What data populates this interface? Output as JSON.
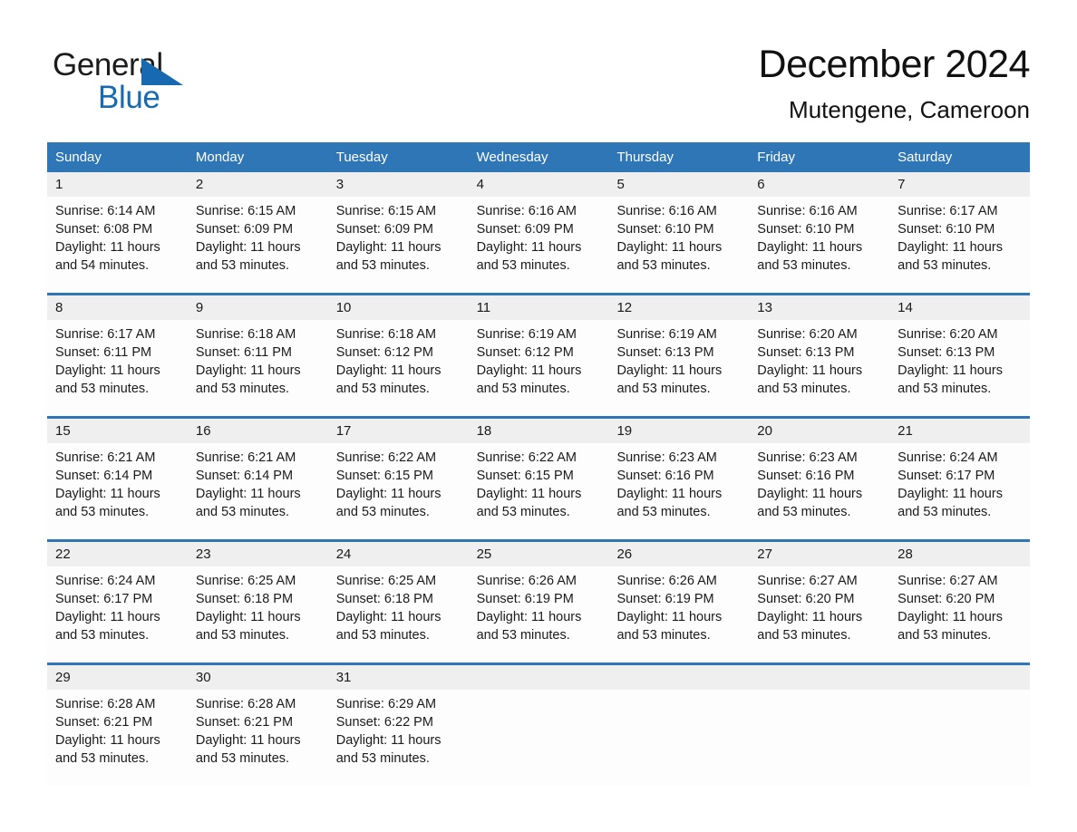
{
  "brand": {
    "word_one": "General",
    "word_two": "Blue",
    "triangle_color": "#1769b0",
    "blue_text_color": "#1769b0"
  },
  "header": {
    "month_title": "December 2024",
    "location": "Mutengene, Cameroon"
  },
  "theme": {
    "header_blue": "#2f76b6",
    "date_band_gray": "#efefef",
    "rule_blue": "#2f76b6"
  },
  "calendar": {
    "day_headers": [
      "Sunday",
      "Monday",
      "Tuesday",
      "Wednesday",
      "Thursday",
      "Friday",
      "Saturday"
    ],
    "weeks": [
      {
        "dates": [
          "1",
          "2",
          "3",
          "4",
          "5",
          "6",
          "7"
        ],
        "cells": [
          {
            "sunrise": "Sunrise: 6:14 AM",
            "sunset": "Sunset: 6:08 PM",
            "daylight_a": "Daylight: 11 hours",
            "daylight_b": "and 54 minutes."
          },
          {
            "sunrise": "Sunrise: 6:15 AM",
            "sunset": "Sunset: 6:09 PM",
            "daylight_a": "Daylight: 11 hours",
            "daylight_b": "and 53 minutes."
          },
          {
            "sunrise": "Sunrise: 6:15 AM",
            "sunset": "Sunset: 6:09 PM",
            "daylight_a": "Daylight: 11 hours",
            "daylight_b": "and 53 minutes."
          },
          {
            "sunrise": "Sunrise: 6:16 AM",
            "sunset": "Sunset: 6:09 PM",
            "daylight_a": "Daylight: 11 hours",
            "daylight_b": "and 53 minutes."
          },
          {
            "sunrise": "Sunrise: 6:16 AM",
            "sunset": "Sunset: 6:10 PM",
            "daylight_a": "Daylight: 11 hours",
            "daylight_b": "and 53 minutes."
          },
          {
            "sunrise": "Sunrise: 6:16 AM",
            "sunset": "Sunset: 6:10 PM",
            "daylight_a": "Daylight: 11 hours",
            "daylight_b": "and 53 minutes."
          },
          {
            "sunrise": "Sunrise: 6:17 AM",
            "sunset": "Sunset: 6:10 PM",
            "daylight_a": "Daylight: 11 hours",
            "daylight_b": "and 53 minutes."
          }
        ]
      },
      {
        "dates": [
          "8",
          "9",
          "10",
          "11",
          "12",
          "13",
          "14"
        ],
        "cells": [
          {
            "sunrise": "Sunrise: 6:17 AM",
            "sunset": "Sunset: 6:11 PM",
            "daylight_a": "Daylight: 11 hours",
            "daylight_b": "and 53 minutes."
          },
          {
            "sunrise": "Sunrise: 6:18 AM",
            "sunset": "Sunset: 6:11 PM",
            "daylight_a": "Daylight: 11 hours",
            "daylight_b": "and 53 minutes."
          },
          {
            "sunrise": "Sunrise: 6:18 AM",
            "sunset": "Sunset: 6:12 PM",
            "daylight_a": "Daylight: 11 hours",
            "daylight_b": "and 53 minutes."
          },
          {
            "sunrise": "Sunrise: 6:19 AM",
            "sunset": "Sunset: 6:12 PM",
            "daylight_a": "Daylight: 11 hours",
            "daylight_b": "and 53 minutes."
          },
          {
            "sunrise": "Sunrise: 6:19 AM",
            "sunset": "Sunset: 6:13 PM",
            "daylight_a": "Daylight: 11 hours",
            "daylight_b": "and 53 minutes."
          },
          {
            "sunrise": "Sunrise: 6:20 AM",
            "sunset": "Sunset: 6:13 PM",
            "daylight_a": "Daylight: 11 hours",
            "daylight_b": "and 53 minutes."
          },
          {
            "sunrise": "Sunrise: 6:20 AM",
            "sunset": "Sunset: 6:13 PM",
            "daylight_a": "Daylight: 11 hours",
            "daylight_b": "and 53 minutes."
          }
        ]
      },
      {
        "dates": [
          "15",
          "16",
          "17",
          "18",
          "19",
          "20",
          "21"
        ],
        "cells": [
          {
            "sunrise": "Sunrise: 6:21 AM",
            "sunset": "Sunset: 6:14 PM",
            "daylight_a": "Daylight: 11 hours",
            "daylight_b": "and 53 minutes."
          },
          {
            "sunrise": "Sunrise: 6:21 AM",
            "sunset": "Sunset: 6:14 PM",
            "daylight_a": "Daylight: 11 hours",
            "daylight_b": "and 53 minutes."
          },
          {
            "sunrise": "Sunrise: 6:22 AM",
            "sunset": "Sunset: 6:15 PM",
            "daylight_a": "Daylight: 11 hours",
            "daylight_b": "and 53 minutes."
          },
          {
            "sunrise": "Sunrise: 6:22 AM",
            "sunset": "Sunset: 6:15 PM",
            "daylight_a": "Daylight: 11 hours",
            "daylight_b": "and 53 minutes."
          },
          {
            "sunrise": "Sunrise: 6:23 AM",
            "sunset": "Sunset: 6:16 PM",
            "daylight_a": "Daylight: 11 hours",
            "daylight_b": "and 53 minutes."
          },
          {
            "sunrise": "Sunrise: 6:23 AM",
            "sunset": "Sunset: 6:16 PM",
            "daylight_a": "Daylight: 11 hours",
            "daylight_b": "and 53 minutes."
          },
          {
            "sunrise": "Sunrise: 6:24 AM",
            "sunset": "Sunset: 6:17 PM",
            "daylight_a": "Daylight: 11 hours",
            "daylight_b": "and 53 minutes."
          }
        ]
      },
      {
        "dates": [
          "22",
          "23",
          "24",
          "25",
          "26",
          "27",
          "28"
        ],
        "cells": [
          {
            "sunrise": "Sunrise: 6:24 AM",
            "sunset": "Sunset: 6:17 PM",
            "daylight_a": "Daylight: 11 hours",
            "daylight_b": "and 53 minutes."
          },
          {
            "sunrise": "Sunrise: 6:25 AM",
            "sunset": "Sunset: 6:18 PM",
            "daylight_a": "Daylight: 11 hours",
            "daylight_b": "and 53 minutes."
          },
          {
            "sunrise": "Sunrise: 6:25 AM",
            "sunset": "Sunset: 6:18 PM",
            "daylight_a": "Daylight: 11 hours",
            "daylight_b": "and 53 minutes."
          },
          {
            "sunrise": "Sunrise: 6:26 AM",
            "sunset": "Sunset: 6:19 PM",
            "daylight_a": "Daylight: 11 hours",
            "daylight_b": "and 53 minutes."
          },
          {
            "sunrise": "Sunrise: 6:26 AM",
            "sunset": "Sunset: 6:19 PM",
            "daylight_a": "Daylight: 11 hours",
            "daylight_b": "and 53 minutes."
          },
          {
            "sunrise": "Sunrise: 6:27 AM",
            "sunset": "Sunset: 6:20 PM",
            "daylight_a": "Daylight: 11 hours",
            "daylight_b": "and 53 minutes."
          },
          {
            "sunrise": "Sunrise: 6:27 AM",
            "sunset": "Sunset: 6:20 PM",
            "daylight_a": "Daylight: 11 hours",
            "daylight_b": "and 53 minutes."
          }
        ]
      },
      {
        "dates": [
          "29",
          "30",
          "31",
          "",
          "",
          "",
          ""
        ],
        "cells": [
          {
            "sunrise": "Sunrise: 6:28 AM",
            "sunset": "Sunset: 6:21 PM",
            "daylight_a": "Daylight: 11 hours",
            "daylight_b": "and 53 minutes."
          },
          {
            "sunrise": "Sunrise: 6:28 AM",
            "sunset": "Sunset: 6:21 PM",
            "daylight_a": "Daylight: 11 hours",
            "daylight_b": "and 53 minutes."
          },
          {
            "sunrise": "Sunrise: 6:29 AM",
            "sunset": "Sunset: 6:22 PM",
            "daylight_a": "Daylight: 11 hours",
            "daylight_b": "and 53 minutes."
          },
          {
            "sunrise": "",
            "sunset": "",
            "daylight_a": "",
            "daylight_b": ""
          },
          {
            "sunrise": "",
            "sunset": "",
            "daylight_a": "",
            "daylight_b": ""
          },
          {
            "sunrise": "",
            "sunset": "",
            "daylight_a": "",
            "daylight_b": ""
          },
          {
            "sunrise": "",
            "sunset": "",
            "daylight_a": "",
            "daylight_b": ""
          }
        ]
      }
    ]
  }
}
